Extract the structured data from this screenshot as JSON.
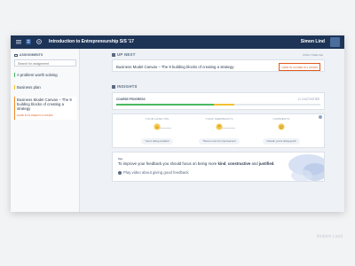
{
  "topbar": {
    "title": "Introduction to Entrepreneurship S/S '17",
    "user": "Simon Lind",
    "icons": [
      "menu-icon",
      "document-icon",
      "gear-icon"
    ]
  },
  "sidebar": {
    "heading": "ASSIGNMENTS",
    "search_placeholder": "Search for assignment",
    "items": [
      {
        "label": "A problem worth solving",
        "accent": "#4cb862"
      },
      {
        "label": "Business plan",
        "accent": "#f2c230"
      },
      {
        "label": "Business Model Canvas – The 9 building blocks of creating a strategy",
        "accent": "#f08a24",
        "note": "HAND IN CLOSED IN 2 HOURS"
      }
    ]
  },
  "up_next": {
    "heading": "UP NEXT",
    "open_timeline": "OPEN TIMELINE",
    "item": "Business Model Canvas – The 9 building blocks of creating a strategy",
    "badge": "HAND IN CLOSED IN 2 HOURS"
  },
  "insights": {
    "heading": "INSIGHTS",
    "course_progress_label": "COURSE PROGRESS",
    "course_progress_count": "3 / 3 ACTIVITIES",
    "progress_segments": [
      {
        "color": "#4cb862",
        "fraction": 0.48
      },
      {
        "color": "#f2c230",
        "fraction": 0.1
      }
    ],
    "feedback": [
      {
        "title": "YOUR HAND INS",
        "pill": "You're doing excellent",
        "icon": "thumbs-up-icon"
      },
      {
        "title": "YOUR FEEDBACK'S",
        "pill": "There's room for improvement",
        "icon": "thumbs-down-icon"
      },
      {
        "title": "COMMENTS",
        "pill": "Overall, you're doing good!",
        "icon": "smiley-icon"
      }
    ],
    "tip": {
      "label": "tips",
      "text_before": "To improve your feedback you should focus on being more ",
      "kind": "kind",
      "comma": ", ",
      "constructive": "constructive",
      "and": " and ",
      "justified": "justified",
      "period": ".",
      "video": "Play video about giving good feedback"
    }
  },
  "credit": "Ibrahim Lund",
  "colors": {
    "topbar": "#1d3457",
    "accent_green": "#4cb862",
    "accent_yellow": "#f2c230",
    "accent_orange": "#f08a24"
  }
}
